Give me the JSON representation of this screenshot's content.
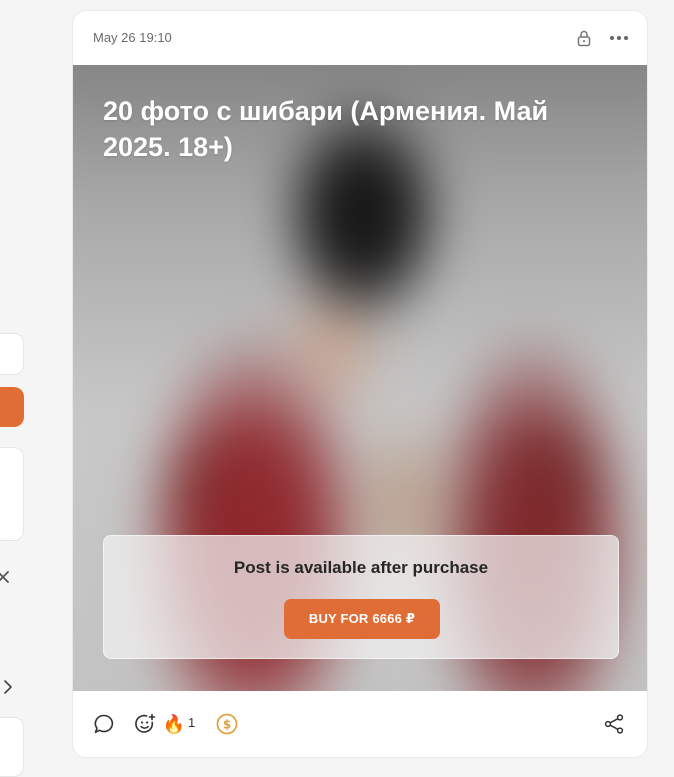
{
  "post": {
    "date": "May 26 19:10",
    "title": "20 фото с шибари (Армения. Май 2025. 18+)",
    "locked_message": "Post is available after purchase",
    "buy_label": "BUY FOR 6666 ₽",
    "reactions": [
      {
        "icon": "fire-icon",
        "emoji": "🔥",
        "count": "1"
      }
    ]
  },
  "icons": {
    "lock": "lock-icon",
    "more": "more-dots-icon",
    "comment": "comment-bubble-icon",
    "add_reaction": "add-reaction-icon",
    "tip": "coin-dollar-icon",
    "share": "share-icon"
  },
  "colors": {
    "accent": "#e06d36",
    "card_bg": "#ffffff",
    "page_bg": "#f5f5f6",
    "tip_icon": "#e0a23a"
  }
}
